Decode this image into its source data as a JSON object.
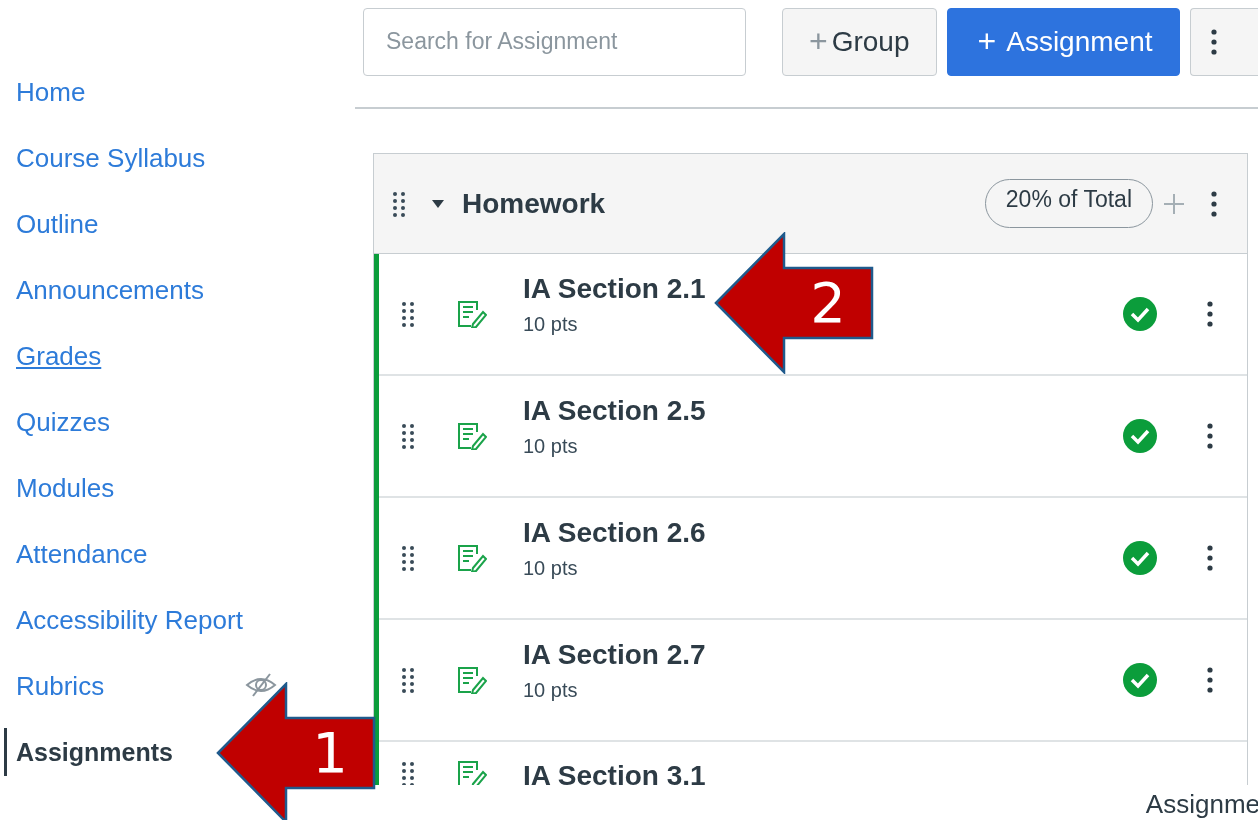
{
  "sidebar": {
    "items": [
      {
        "label": "Home",
        "selected": false,
        "hidden": false
      },
      {
        "label": "Course Syllabus",
        "selected": false,
        "hidden": false
      },
      {
        "label": "Outline",
        "selected": false,
        "hidden": false
      },
      {
        "label": "Announcements",
        "selected": false,
        "hidden": false
      },
      {
        "label": "Grades",
        "selected": false,
        "hidden": false,
        "underlined": true
      },
      {
        "label": "Quizzes",
        "selected": false,
        "hidden": false
      },
      {
        "label": "Modules",
        "selected": false,
        "hidden": false
      },
      {
        "label": "Attendance",
        "selected": false,
        "hidden": false
      },
      {
        "label": "Accessibility Report",
        "selected": false,
        "hidden": false
      },
      {
        "label": "Rubrics",
        "selected": false,
        "hidden": true
      },
      {
        "label": "Assignments",
        "selected": true,
        "hidden": false
      }
    ]
  },
  "toolbar": {
    "search": {
      "placeholder": "Search for Assignment"
    },
    "group_button": {
      "icon": "+",
      "label": "Group"
    },
    "assignment_button": {
      "icon": "+",
      "label": "Assignment"
    }
  },
  "group": {
    "title": "Homework",
    "expanded": true,
    "weight": "20% of Total",
    "assignments": [
      {
        "title": "IA Section 2.1",
        "points": "10 pts",
        "published": true
      },
      {
        "title": "IA Section 2.5",
        "points": "10 pts",
        "published": true
      },
      {
        "title": "IA Section 2.6",
        "points": "10 pts",
        "published": true
      },
      {
        "title": "IA Section 2.7",
        "points": "10 pts",
        "published": true
      },
      {
        "title": "IA Section 3.1"
      }
    ]
  },
  "footer_text": "Assignme",
  "callouts": [
    {
      "label": "2"
    },
    {
      "label": "1"
    }
  ]
}
